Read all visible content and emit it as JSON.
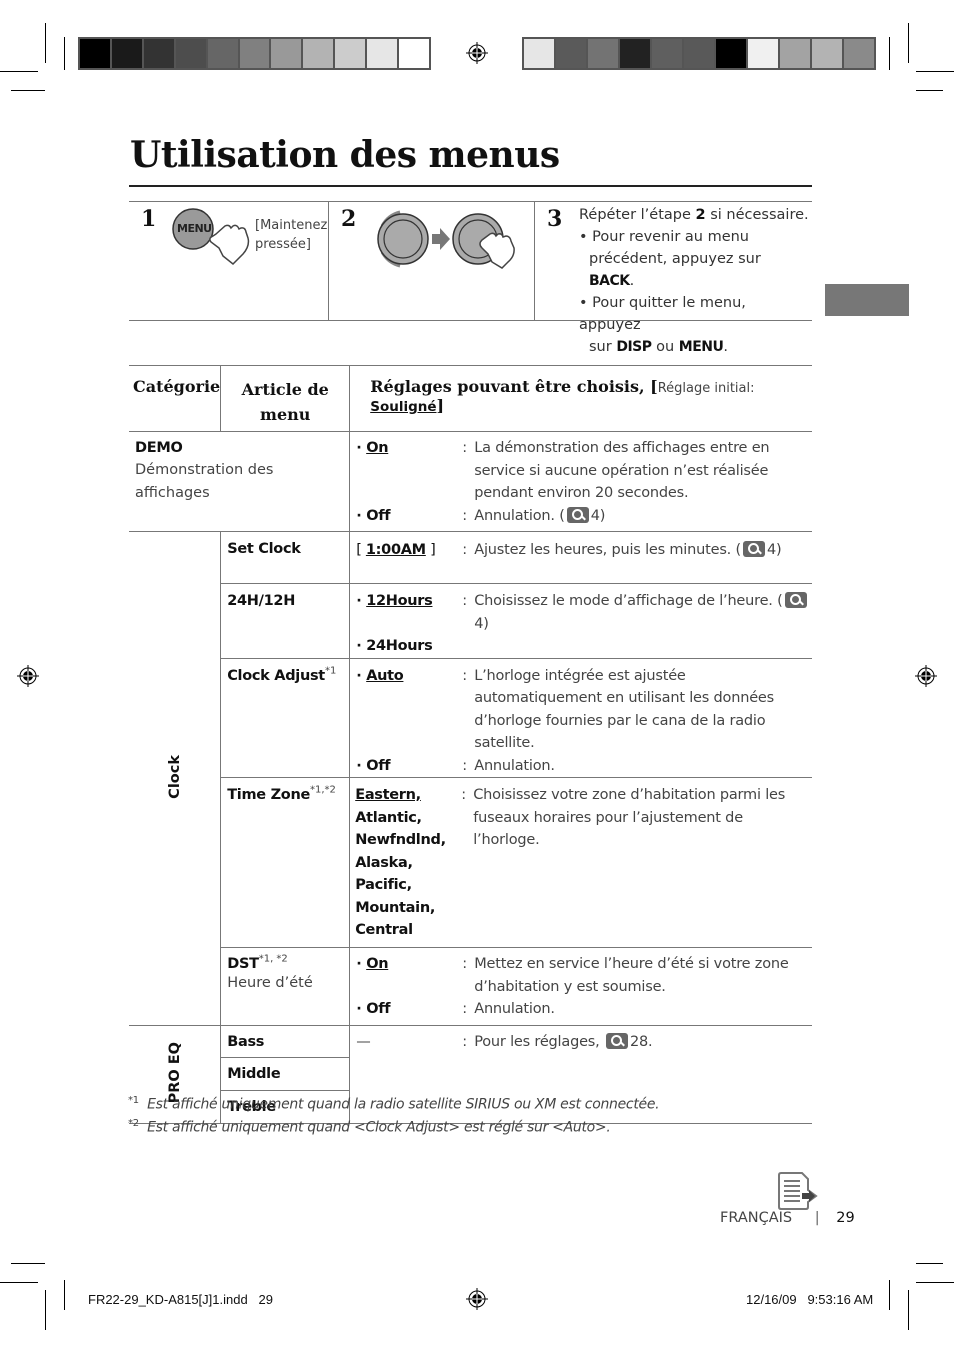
{
  "printer_marks": {
    "left_colorbar": [
      "#000000",
      "#1a1a1a",
      "#333333",
      "#4d4d4d",
      "#666666",
      "#808080",
      "#999999",
      "#b3b3b3",
      "#cccccc",
      "#e6e6e6",
      "#ffffff"
    ],
    "right_colorbar": [
      "#e6e6e6",
      "#5a5a5a",
      "#737373",
      "#222222",
      "#5f5f5f",
      "#595959",
      "#000000",
      "#f0f0f0",
      "#a3a3a3",
      "#b3b3b3",
      "#8a8a8a"
    ]
  },
  "page": {
    "title": "Utilisation des menus",
    "steps": {
      "step1": {
        "number": "1",
        "button_label": "MENU",
        "note_line1": "[Maintenez",
        "note_line2": "pressée]"
      },
      "step2": {
        "number": "2"
      },
      "step3": {
        "number": "3",
        "intro_pre": "Répéter l’étape ",
        "intro_bold": "2",
        "intro_post": " si nécessaire.",
        "bullet1_pre": "Pour revenir au menu",
        "bullet1_line2_pre": "précédent, appuyez sur ",
        "bullet1_key": "BACK",
        "bullet2_pre": "Pour quitter le menu, appuyez",
        "bullet2_line2_pre": "sur ",
        "bullet2_key1": "DISP",
        "bullet2_or": " ou ",
        "bullet2_key2": "MENU"
      }
    },
    "table": {
      "headers": {
        "category": "Catégorie",
        "item": "Article de menu",
        "settings_bold": "Réglages pouvant être choisis, [",
        "settings_small": "Réglage initial: ",
        "settings_underlined": "Souligné",
        "settings_close": "]"
      },
      "demo": {
        "name": "DEMO",
        "subtitle": "Démonstration des affichages",
        "options": [
          {
            "label": "On",
            "default": true,
            "desc": "La démonstration des affichages entre en service si aucune opération n’est réalisée pendant environ 20 secondes."
          },
          {
            "label": "Off",
            "default": false,
            "desc": "Annulation. (",
            "ref": "4)"
          }
        ]
      },
      "clock": {
        "category": "Clock",
        "rows": [
          {
            "item": "Set Clock",
            "option": "1:00AM",
            "desc": "Ajustez les heures, puis les minutes. (",
            "ref": "4)"
          },
          {
            "item": "24H/12H",
            "options": [
              "12Hours",
              "24Hours"
            ],
            "desc": "Choisissez le mode d’affichage de l’heure. (",
            "ref": "4)"
          },
          {
            "item": "Clock Adjust",
            "sup": "*1",
            "options": [
              {
                "label": "Auto",
                "desc": "L’horloge intégrée est ajustée automatiquement en utilisant les données d’horloge fournies par le cana de la radio satellite."
              },
              {
                "label": "Off",
                "desc": "Annulation."
              }
            ]
          },
          {
            "item": "Time Zone",
            "sup": "*1,*2",
            "options": [
              "Eastern,",
              "Atlantic,",
              "Newfndlnd,",
              "Alaska,",
              "Pacific,",
              "Mountain,",
              "Central"
            ],
            "desc": "Choisissez votre zone d’habitation parmi les fuseaux horaires pour l’ajustement de l’horloge."
          },
          {
            "item": "DST",
            "sup": "*1, *2",
            "subtitle": "Heure d’été",
            "options": [
              {
                "label": "On",
                "desc": "Mettez en service l’heure d’été si votre zone d’habitation y est soumise."
              },
              {
                "label": "Off",
                "desc": "Annulation."
              }
            ]
          }
        ]
      },
      "pro_eq": {
        "category": "PRO EQ",
        "items": [
          "Bass",
          "Middle",
          "Treble"
        ],
        "option": "—",
        "desc": "Pour les réglages, ",
        "ref": "28."
      }
    },
    "footnotes": [
      {
        "mark": "*1",
        "text": "Est affiché uniquement quand la radio satellite SIRIUS ou XM est connectée."
      },
      {
        "mark": "*2",
        "text": "Est affiché uniquement quand <Clock Adjust> est réglé sur <Auto>."
      }
    ],
    "footer": {
      "language": "FRANÇAIS",
      "separator": "|",
      "page_number": "29"
    }
  },
  "slug": {
    "file": "FR22-29_KD-A815[J]1.indd   29",
    "timestamp": "12/16/09   9:53:16 AM"
  },
  "icons": {
    "reference": "magnifier-reference-icon",
    "continue": "continue-page-icon"
  }
}
